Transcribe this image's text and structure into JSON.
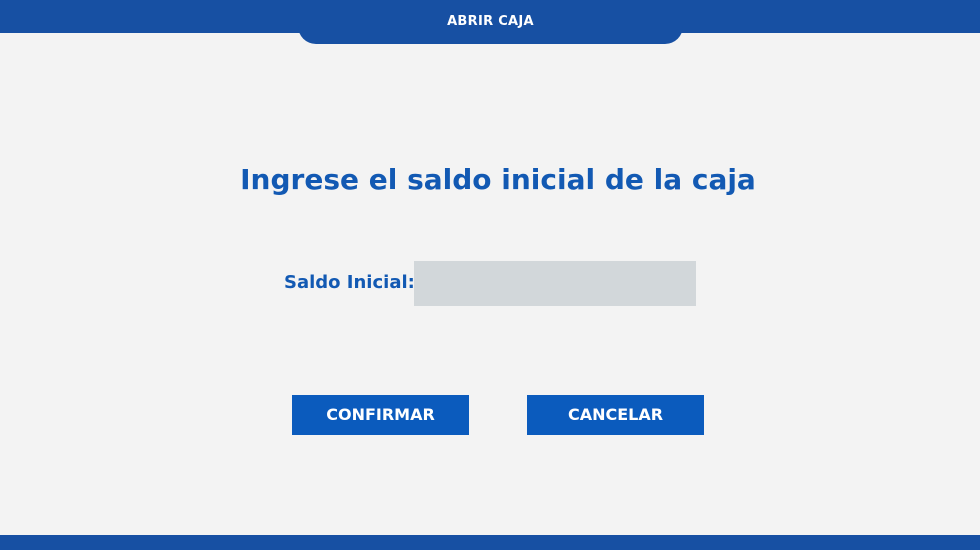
{
  "header": {
    "tab_title": "ABRIR CAJA"
  },
  "main": {
    "heading": "Ingrese el saldo inicial de la caja",
    "field_label": "Saldo Inicial:",
    "field_value": "",
    "field_placeholder": ""
  },
  "actions": {
    "confirm_label": "CONFIRMAR",
    "cancel_label": "CANCELAR"
  },
  "colors": {
    "brand_blue": "#1750a3",
    "accent_blue": "#0b5bbd",
    "text_blue": "#1259b3",
    "input_bg": "#d2d7da",
    "page_bg": "#f3f3f3"
  }
}
